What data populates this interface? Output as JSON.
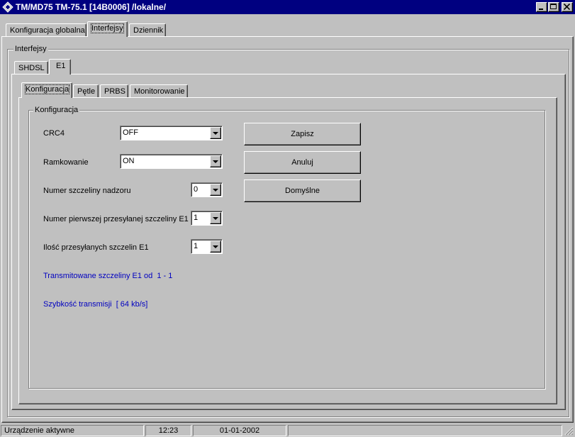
{
  "window": {
    "title": "TM/MD75 TM-75.1 [14B0006] /lokalne/"
  },
  "main_tabs": [
    {
      "label": "Konfiguracja globalna"
    },
    {
      "label": "Interfejsy"
    },
    {
      "label": "Dziennik"
    }
  ],
  "interfaces_group": {
    "legend": "Interfejsy"
  },
  "interface_tabs": [
    {
      "label": "SHDSL"
    },
    {
      "label": "E1"
    }
  ],
  "e1_tabs": [
    {
      "label": "Konfiguracja"
    },
    {
      "label": "Pętle"
    },
    {
      "label": "PRBS"
    },
    {
      "label": "Monitorowanie"
    }
  ],
  "config_group": {
    "legend": "Konfiguracja",
    "fields": {
      "crc4": {
        "label": "CRC4",
        "value": "OFF"
      },
      "framing": {
        "label": "Ramkowanie",
        "value": "ON"
      },
      "supervision_slot": {
        "label": "Numer szczeliny nadzoru",
        "value": "0"
      },
      "first_slot": {
        "label": "Numer pierwszej przesyłanej szczeliny E1",
        "value": "1"
      },
      "slot_count": {
        "label": "Ilość przesyłanych szczelin E1",
        "value": "1"
      }
    },
    "info": {
      "transmitted_slots": "Transmitowane szczeliny E1 od  1 - 1",
      "speed": "Szybkość transmisji  [ 64 kb/s]"
    },
    "buttons": {
      "save": "Zapisz",
      "cancel": "Anuluj",
      "defaults": "Domyślne"
    }
  },
  "statusbar": {
    "state": "Urządzenie aktywne",
    "time": "12:23",
    "date": "01-01-2002"
  },
  "colors": {
    "titlebar": "#000080",
    "face": "#c0c0c0",
    "info_text": "#0000c0"
  }
}
